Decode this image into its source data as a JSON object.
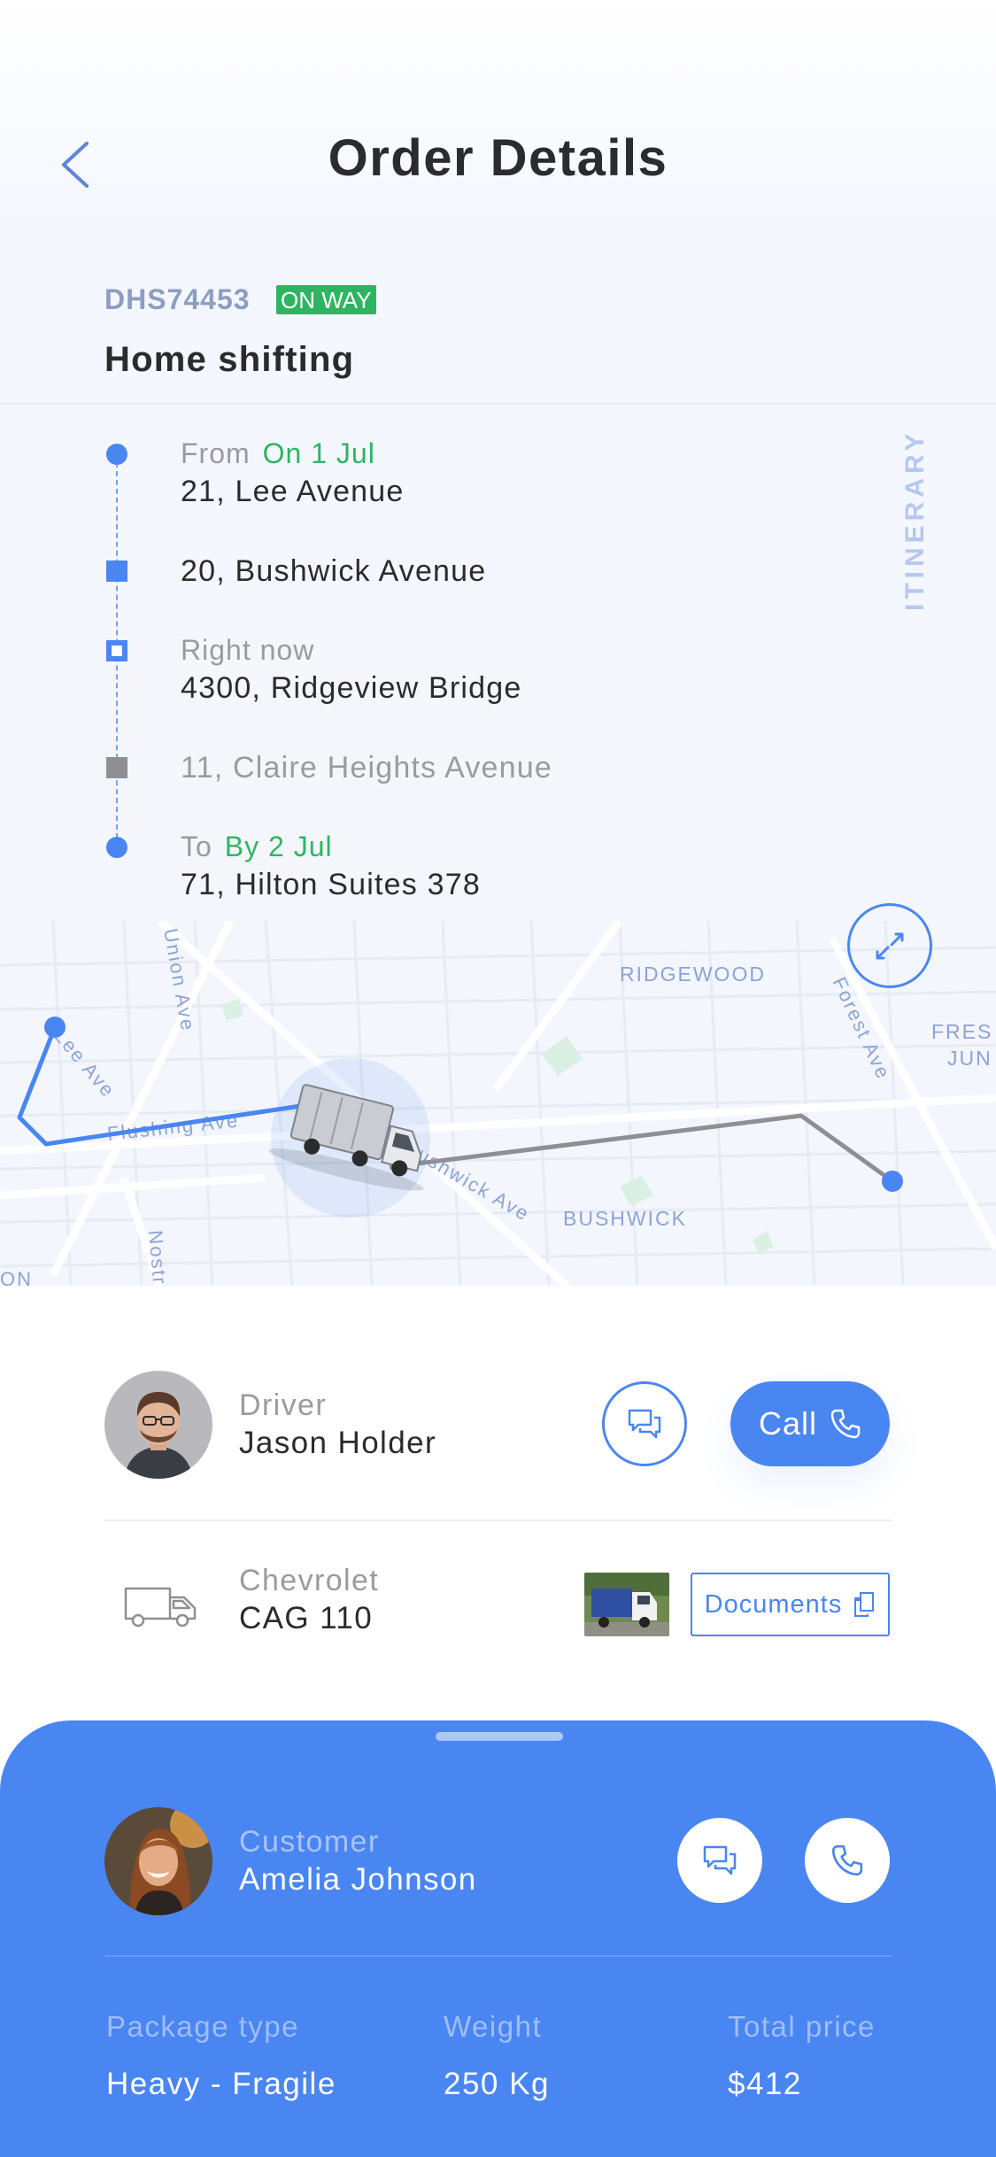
{
  "header": {
    "title": "Order Details",
    "back_icon": "chevron-left-icon"
  },
  "order": {
    "id": "DHS74453",
    "status": "ON WAY",
    "type": "Home shifting"
  },
  "itinerary": {
    "label": "ITINERARY",
    "stops": [
      {
        "marker": "dot",
        "label": "From",
        "date": "On 1 Jul",
        "address": "21, Lee Avenue"
      },
      {
        "marker": "square",
        "address": "20, Bushwick Avenue"
      },
      {
        "marker": "hollow-square",
        "label": "Right now",
        "address": "4300, Ridgeview Bridge"
      },
      {
        "marker": "grey-square",
        "address": "11, Claire Heights Avenue"
      },
      {
        "marker": "dot",
        "label": "To",
        "date": "By 2 Jul",
        "address": "71, Hilton Suites 378"
      }
    ]
  },
  "map": {
    "labels": {
      "union": "Union Ave",
      "lee": "Lee Ave",
      "flushing": "Flushing Ave",
      "bushwick_ave": "Bushwick Ave",
      "nostrand": "Nostr",
      "ridgewood": "RIDGEWOOD",
      "forest": "Forest Ave",
      "fresh1": "FRES",
      "fresh2": "JUN",
      "bushwick": "BUSHWICK",
      "edge": "ON"
    },
    "expand_icon": "expand-icon"
  },
  "driver": {
    "role": "Driver",
    "name": "Jason Holder",
    "call_label": "Call",
    "message_icon": "chat-icon",
    "phone_icon": "phone-icon"
  },
  "vehicle": {
    "make": "Chevrolet",
    "plate": "CAG 110",
    "icon": "truck-icon",
    "documents_label": "Documents"
  },
  "customer": {
    "role": "Customer",
    "name": "Amelia Johnson"
  },
  "package": {
    "type_label": "Package type",
    "type_value": "Heavy - Fragile",
    "weight_label": "Weight",
    "weight_value": "250 Kg",
    "price_label": "Total price",
    "price_value": "$412"
  },
  "colors": {
    "accent": "#4A86F1",
    "success": "#2FB463",
    "muted": "#9A9AA0"
  }
}
